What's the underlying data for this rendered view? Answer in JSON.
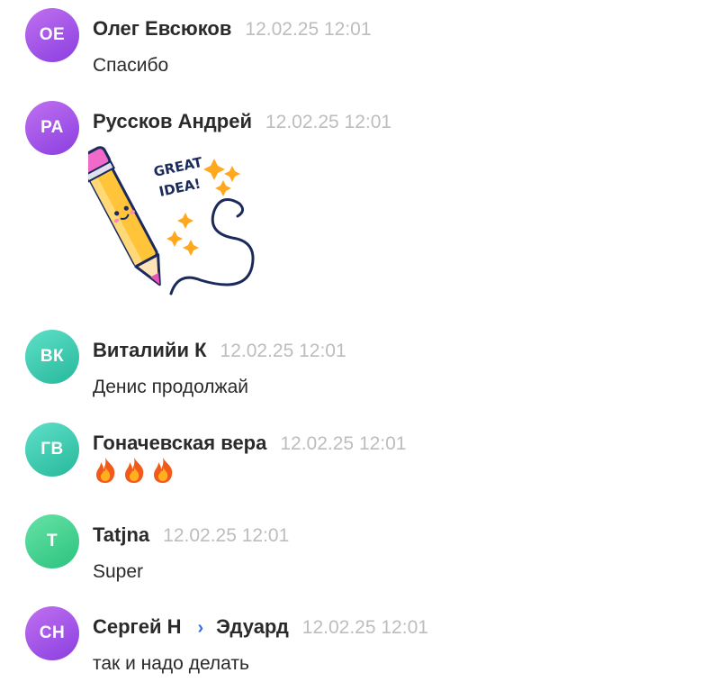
{
  "messages": [
    {
      "initials": "ОЕ",
      "author": "Олег Евсюков",
      "time": "12.02.25 12:01",
      "text": "Спасибо"
    },
    {
      "initials": "РА",
      "author": "Руссков Андрей",
      "time": "12.02.25 12:01",
      "sticker": {
        "icon": "pencil-sticker",
        "caption_line1": "GREAT",
        "caption_line2": "IDEA!"
      }
    },
    {
      "initials": "ВК",
      "author": "Виталийи К",
      "time": "12.02.25 12:01",
      "text": "Денис продолжай"
    },
    {
      "initials": "ГВ",
      "author": "Гоначевская вера",
      "time": "12.02.25 12:01",
      "reactions": [
        "fire-icon",
        "fire-icon",
        "fire-icon"
      ]
    },
    {
      "initials": "T",
      "author": "Tatjna",
      "time": "12.02.25 12:01",
      "text": "Super"
    },
    {
      "initials": "СН",
      "author": "Сергей Н",
      "reply_to": "Эдуард",
      "time": "12.02.25 12:01",
      "text": "так и надо делать"
    }
  ],
  "colors": {
    "avatar_purple": "#9a4ce6",
    "avatar_teal": "#36c2a6",
    "avatar_green": "#3ccb8a",
    "timestamp": "#bdbdbd",
    "reply_arrow": "#2f6fe0"
  }
}
